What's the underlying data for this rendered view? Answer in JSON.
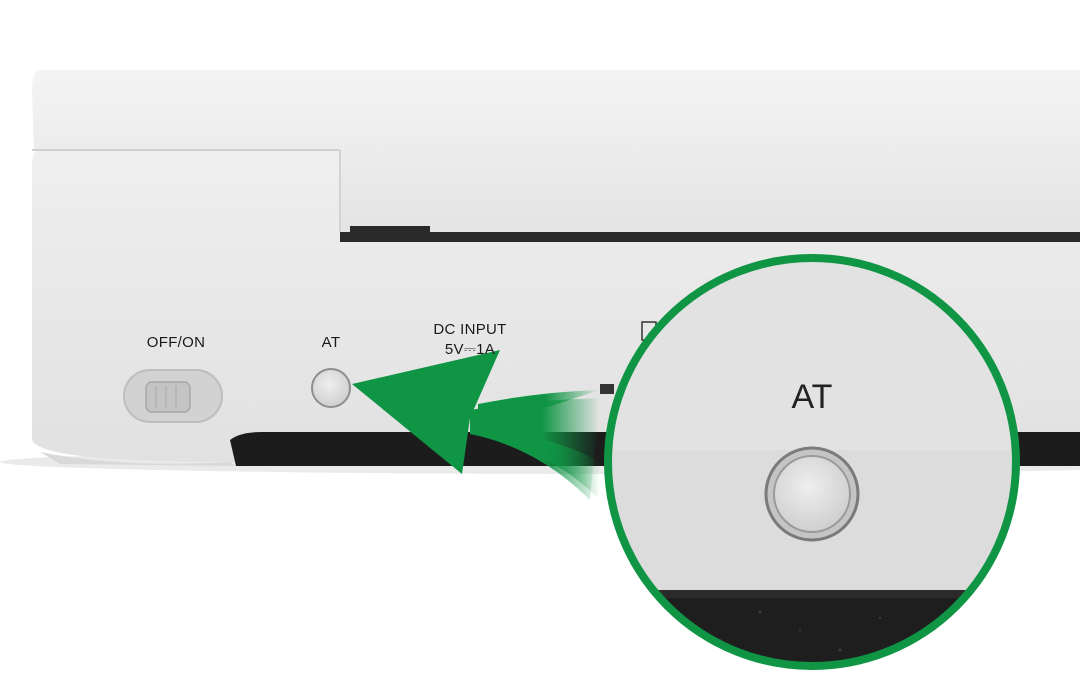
{
  "device": {
    "power_switch_label": "OFF/ON",
    "at_button_label": "AT",
    "dc_input_label": "DC INPUT",
    "dc_input_rating": "5V⎓1A"
  },
  "zoom_callout": {
    "label": "AT"
  },
  "colors": {
    "accent_green": "#109545",
    "device_body": "#e6e6e6",
    "device_shadow": "#1c1c1c"
  }
}
